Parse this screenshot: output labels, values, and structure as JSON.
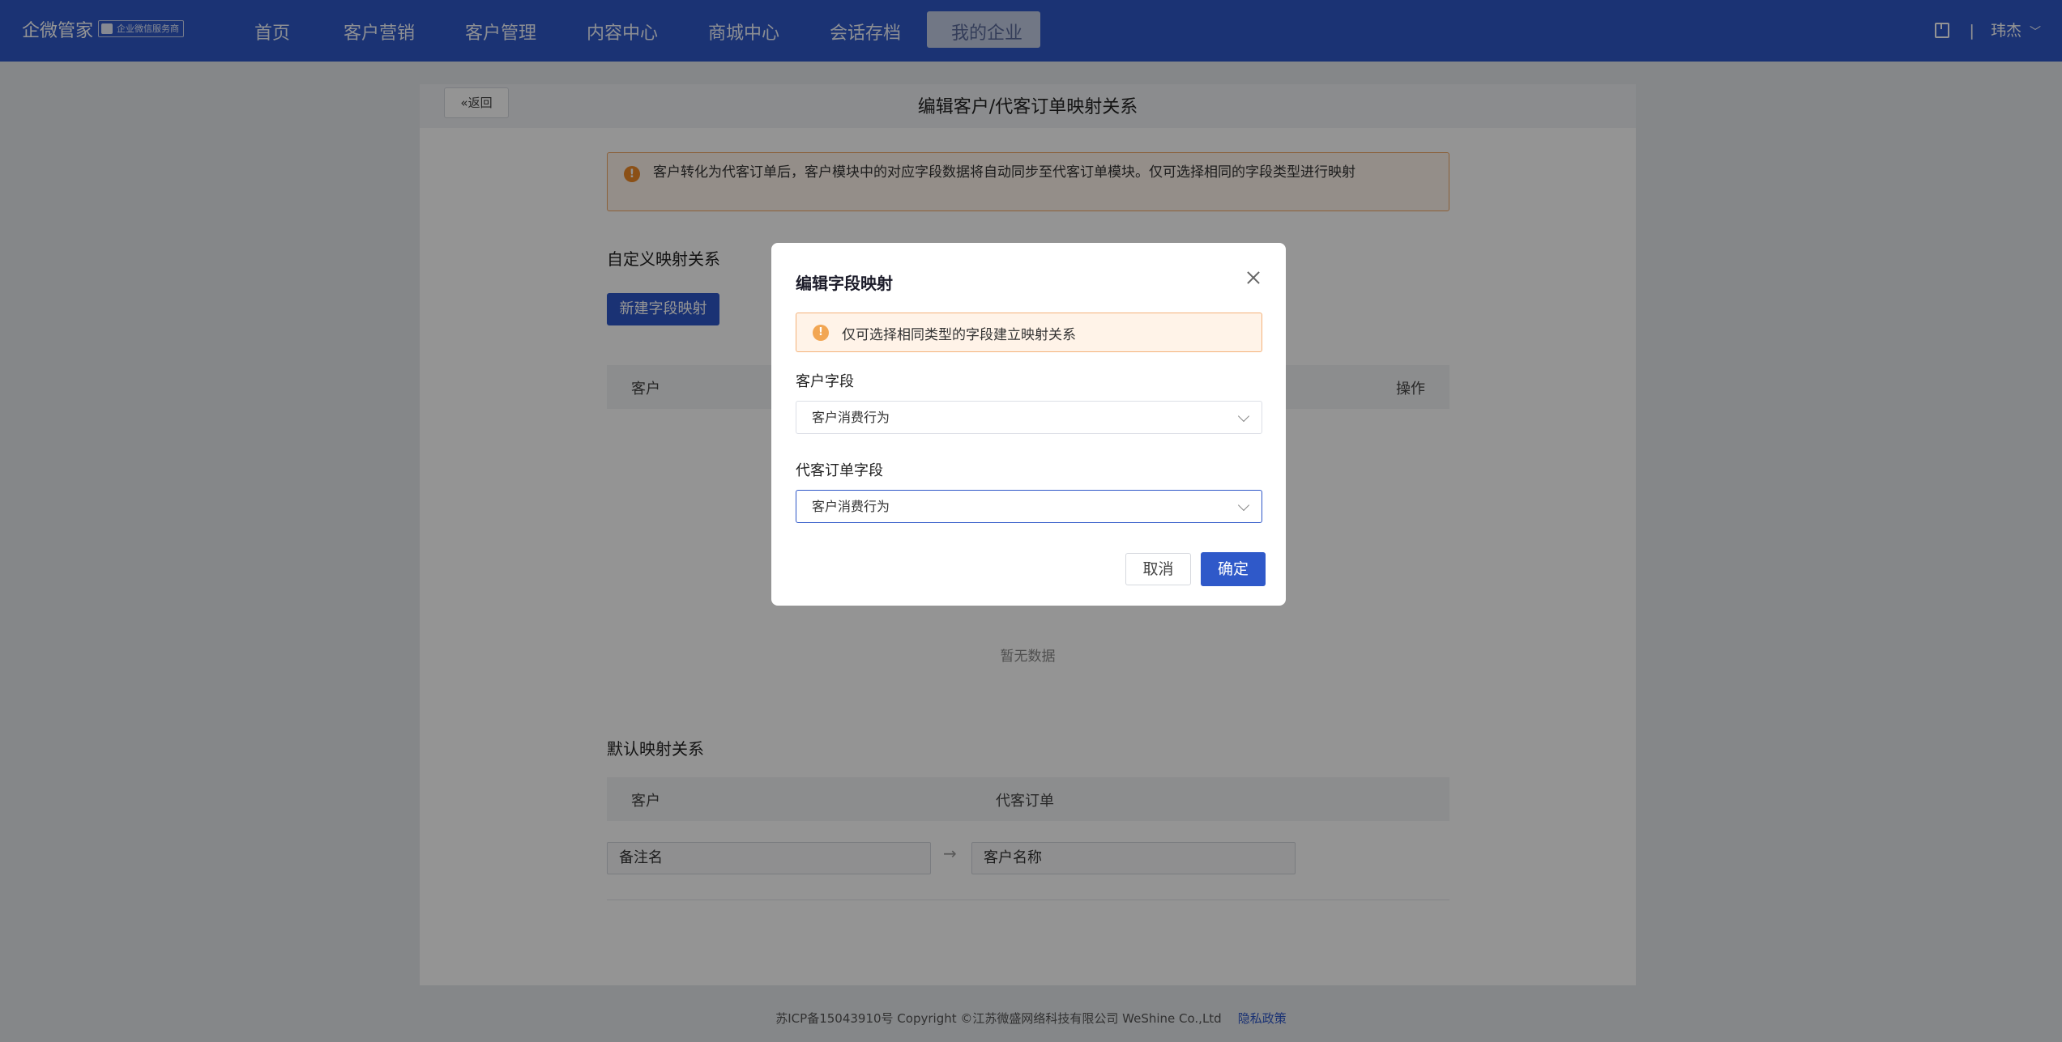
{
  "header": {
    "brand": "企微管家",
    "brand_badge": "企业微信服务商",
    "nav": [
      "首页",
      "客户营销",
      "客户管理",
      "内容中心",
      "商城中心",
      "会话存档"
    ],
    "nav_active": "我的企业",
    "separator": "|",
    "user": "玮杰"
  },
  "page": {
    "back_label": "返回",
    "title": "编辑客户/代客订单映射关系",
    "warning": "客户转化为代客订单后，客户模块中的对应字段数据将自动同步至代客订单模块。仅可选择相同的字段类型进行映射",
    "custom_section_title": "自定义映射关系",
    "new_mapping_button": "新建字段映射",
    "custom_table_headers": {
      "customer": "客户",
      "action": "操作"
    },
    "empty_text": "暂无数据",
    "default_section_title": "默认映射关系",
    "default_table_headers": {
      "customer": "客户",
      "order": "代客订单"
    },
    "default_row": {
      "customer_field": "备注名",
      "arrow": "→",
      "order_field": "客户名称"
    }
  },
  "footer": {
    "icp": "苏ICP备15043910号 Copyright ©江苏微盛网络科技有限公司 WeShine Co.,Ltd",
    "privacy": "隐私政策"
  },
  "modal": {
    "title": "编辑字段映射",
    "warning": "仅可选择相同类型的字段建立映射关系",
    "customer_field_label": "客户字段",
    "customer_field_value": "客户消费行为",
    "order_field_label": "代客订单字段",
    "order_field_value": "客户消费行为",
    "cancel": "取消",
    "confirm": "确定"
  }
}
